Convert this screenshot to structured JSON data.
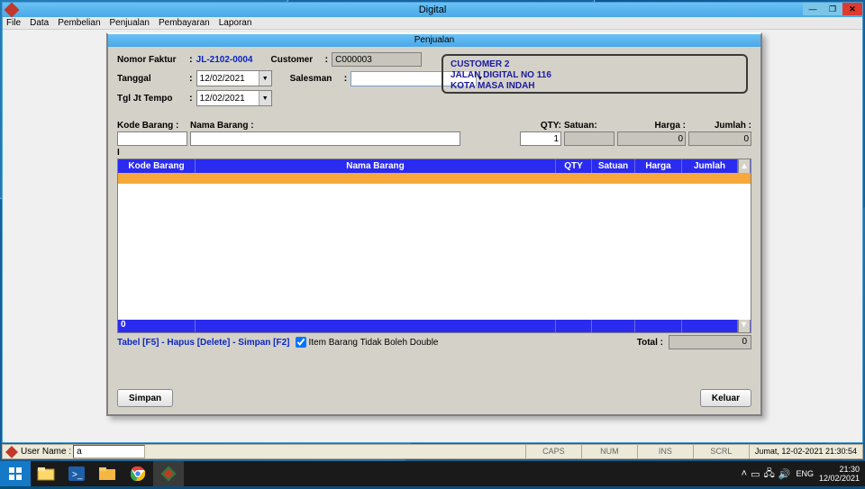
{
  "app": {
    "title": "Digital"
  },
  "menu": {
    "file": "File",
    "data": "Data",
    "pembelian": "Pembelian",
    "penjualan": "Penjualan",
    "pembayaran": "Pembayaran",
    "laporan": "Laporan"
  },
  "subwindow": {
    "title": "Penjualan",
    "labels": {
      "nomor_faktur": "Nomor Faktur",
      "customer": "Customer",
      "tanggal": "Tanggal",
      "salesman": "Salesman",
      "tgl_jt": "Tgl Jt Tempo"
    },
    "invoice_no": "JL-2102-0004",
    "customer_code": "C000003",
    "tanggal": "12/02/2021",
    "salesman": "",
    "tgl_jt": "12/02/2021",
    "customer_info": {
      "name": "CUSTOMER 2",
      "address1": "JALAN DIGITAL NO 116",
      "address2": "KOTA MASA INDAH"
    }
  },
  "entry": {
    "labels": {
      "kode": "Kode Barang :",
      "nama": "Nama Barang :",
      "qty": "QTY:",
      "satuan": "Satuan:",
      "harga": "Harga :",
      "jumlah": "Jumlah :"
    },
    "kode": "",
    "nama": "",
    "qty": "1",
    "satuan": "",
    "harga": "0",
    "jumlah": "0"
  },
  "grid": {
    "headers": {
      "kode": "Kode Barang",
      "nama": "Nama Barang",
      "qty": "QTY",
      "satuan": "Satuan",
      "harga": "Harga",
      "jumlah": "Jumlah"
    },
    "footer_first": "0"
  },
  "below": {
    "hints": "Tabel [F5] - Hapus [Delete] - Simpan [F2]",
    "checkbox_label": "Item Barang Tidak Boleh Double",
    "checkbox_checked": true,
    "total_label": "Total :",
    "total_value": "0"
  },
  "buttons": {
    "simpan": "Simpan",
    "keluar": "Keluar"
  },
  "statusbar": {
    "user_label": "User Name :",
    "user_value": "a",
    "caps": "CAPS",
    "num": "NUM",
    "ins": "INS",
    "scrl": "SCRL",
    "datetime": "Jumat, 12-02-2021 21:30:54"
  },
  "tray": {
    "lang": "ENG",
    "time": "21:30",
    "date": "12/02/2021"
  }
}
